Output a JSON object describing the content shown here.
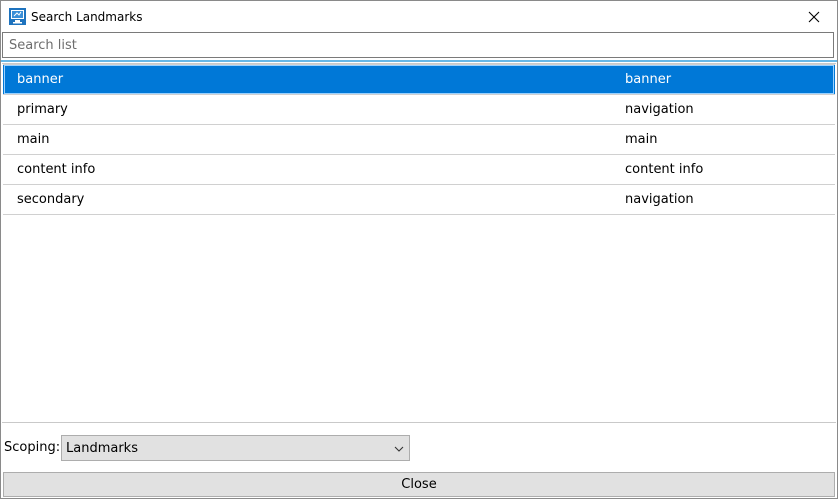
{
  "window": {
    "title": "Search Landmarks",
    "icon": "app-icon",
    "close_icon": "close-icon"
  },
  "search": {
    "placeholder": "Search list",
    "value": ""
  },
  "list": {
    "rows": [
      {
        "name": "banner",
        "role": "banner",
        "selected": true
      },
      {
        "name": "primary",
        "role": "navigation",
        "selected": false
      },
      {
        "name": "main",
        "role": "main",
        "selected": false
      },
      {
        "name": "content info",
        "role": "content info",
        "selected": false
      },
      {
        "name": "secondary",
        "role": "navigation",
        "selected": false
      }
    ]
  },
  "scoping": {
    "label": "Scoping:",
    "value": "Landmarks",
    "icon": "chevron-down-icon"
  },
  "footer": {
    "close_label": "Close"
  },
  "colors": {
    "selection": "#0078d7",
    "accent_line": "#67b7e6",
    "button_bg": "#e1e1e1"
  }
}
